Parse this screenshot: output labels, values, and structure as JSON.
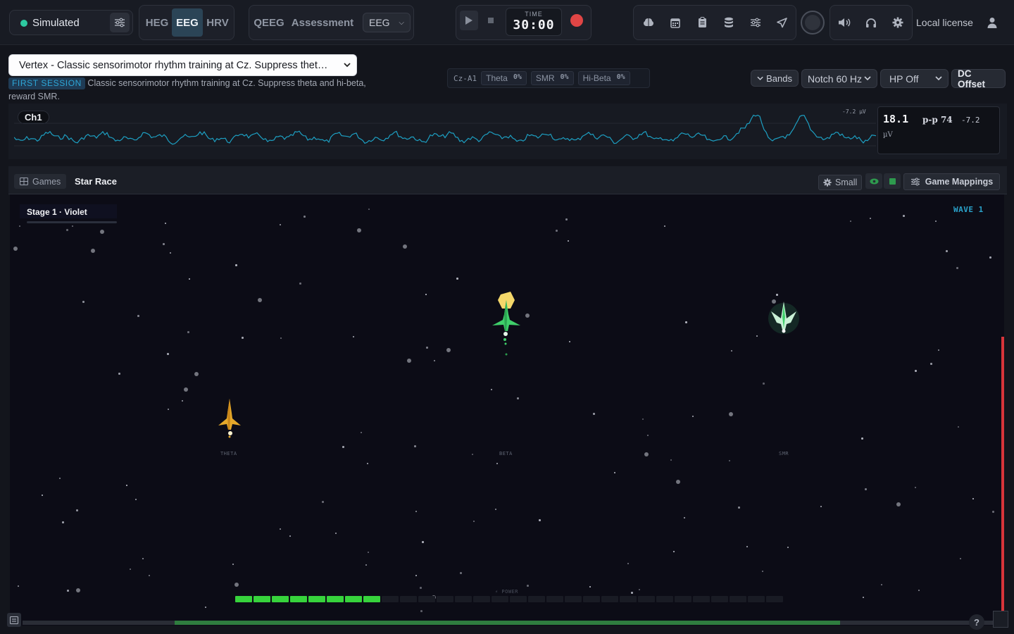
{
  "top": {
    "source": "Simulated",
    "modes": [
      "HEG",
      "EEG",
      "HRV"
    ],
    "active_mode": "EEG",
    "qeeg": "QEEG",
    "assessment": "Assessment",
    "signal_select": "EEG",
    "time_label": "TIME",
    "time_value": "30:00",
    "license": "Local license"
  },
  "protocol": {
    "select_value": "Vertex - Classic sensorimotor rhythm training at Cz. Suppress thet…",
    "badge": "FIRST SESSION",
    "description": "Classic sensorimotor rhythm training at Cz. Suppress theta and hi-beta, reward SMR."
  },
  "meter": {
    "channel": "Cz-A1",
    "bands": [
      {
        "name": "Theta",
        "value": "0%"
      },
      {
        "name": "SMR",
        "value": "0%"
      },
      {
        "name": "Hi-Beta",
        "value": "0%"
      }
    ]
  },
  "filters": {
    "bands": "Bands",
    "notch": "Notch 60 Hz",
    "hp": "HP Off",
    "dc": "DC Offset"
  },
  "signal": {
    "channel": "Ch1",
    "scale": "-7.2 µV",
    "readout_main": "18.1",
    "readout_pp": "p-p 74",
    "readout_min": "-7.2",
    "readout_unit": "µV"
  },
  "game": {
    "games_tab": "Games",
    "title": "Star Race",
    "size": "Small",
    "mappings": "Game Mappings",
    "stage": "Stage 1 · Violet",
    "wave": "WAVE 1",
    "lanes": [
      "THETA",
      "BETA",
      "SMR"
    ],
    "power_label": "⚡ POWER",
    "power_segments_total": 30,
    "power_segments_filled": 8,
    "bottom_progress": 0.69,
    "help": "?"
  },
  "colors": {
    "accent_blue": "#2ea6d6",
    "wave_cyan": "#1d9fc2",
    "power_green": "#37d33c",
    "theta_ship": "#e6a92a",
    "beta_ship": "#3fcf6a",
    "record_red": "#e04545",
    "left_bar": "#b97c1e",
    "right_bar": "#d8343a"
  }
}
